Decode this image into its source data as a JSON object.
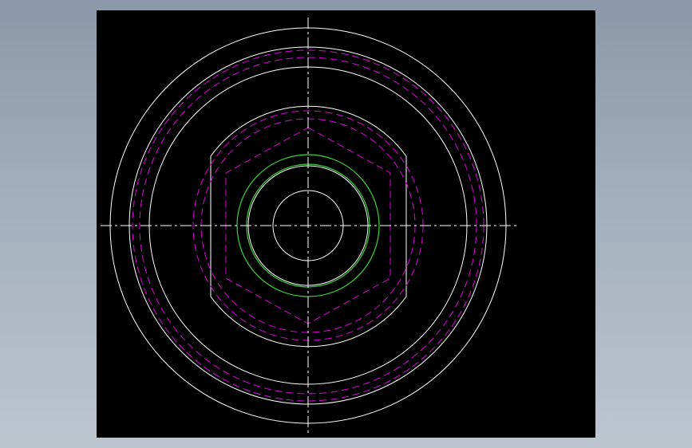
{
  "canvas": {
    "background": "#000000",
    "surround_gradient": [
      "#8a98a9",
      "#bdc6cf"
    ]
  },
  "colors": {
    "visible_edge": "#ffffff",
    "hidden_edge": "#e000e0",
    "thread_edge": "#3cd23c",
    "centerline": "#ffffff"
  },
  "drawing": {
    "view": "top",
    "part": "circular-flange-with-flats",
    "elements": [
      {
        "name": "outer-rim-circle",
        "style": "solid",
        "color_key": "visible_edge"
      },
      {
        "name": "rim-inner-circle",
        "style": "solid",
        "color_key": "visible_edge"
      },
      {
        "name": "groove-circle",
        "style": "solid",
        "color_key": "visible_edge"
      },
      {
        "name": "hidden-ring-outer",
        "style": "dashed",
        "color_key": "hidden_edge"
      },
      {
        "name": "hidden-ring-inner",
        "style": "dashed",
        "color_key": "hidden_edge"
      },
      {
        "name": "hex-boss-outline",
        "style": "solid",
        "color_key": "visible_edge"
      },
      {
        "name": "hidden-boss-outer",
        "style": "dashed",
        "color_key": "hidden_edge"
      },
      {
        "name": "hidden-boss-inner",
        "style": "dashed",
        "color_key": "hidden_edge"
      },
      {
        "name": "thread-outer-circle",
        "style": "solid",
        "color_key": "thread_edge"
      },
      {
        "name": "thread-inner-circle",
        "style": "solid",
        "color_key": "thread_edge"
      },
      {
        "name": "bore-circle",
        "style": "solid",
        "color_key": "visible_edge"
      },
      {
        "name": "horizontal-centerline",
        "style": "dash-dot",
        "color_key": "centerline"
      },
      {
        "name": "vertical-centerline",
        "style": "dash-dot",
        "color_key": "centerline"
      }
    ]
  }
}
